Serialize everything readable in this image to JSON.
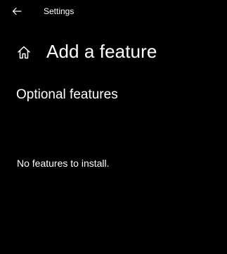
{
  "window": {
    "title": "Settings",
    "back_icon": "arrow-left-icon"
  },
  "header": {
    "home_icon": "home-icon",
    "title": "Add a feature"
  },
  "optional_features": {
    "section_title": "Optional features",
    "empty_message": "No features to install."
  },
  "colors": {
    "background": "#000000",
    "text": "#ffffff"
  }
}
